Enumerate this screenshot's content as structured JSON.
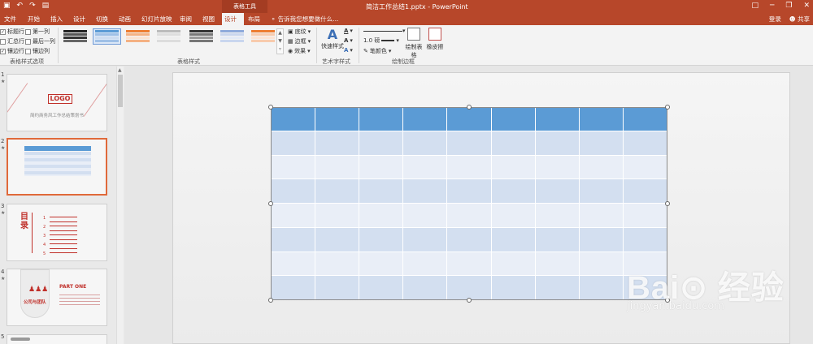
{
  "titlebar": {
    "quick_access": [
      "▣",
      "↶",
      "↷",
      "▤"
    ],
    "context_tab": "表格工具",
    "doc_title": "简洁工作总结1.pptx - PowerPoint",
    "win_buttons": [
      "□",
      "─",
      "❐",
      "✕"
    ]
  },
  "tabs": [
    {
      "label": "文件"
    },
    {
      "label": "开始"
    },
    {
      "label": "插入"
    },
    {
      "label": "设计"
    },
    {
      "label": "切换"
    },
    {
      "label": "动画"
    },
    {
      "label": "幻灯片放映"
    },
    {
      "label": "审阅"
    },
    {
      "label": "视图"
    },
    {
      "label": "设计"
    },
    {
      "label": "布局"
    }
  ],
  "tell_me": "告诉我您想要做什么...",
  "login": "登录",
  "share": "共享",
  "ribbon": {
    "style_options": {
      "label": "表格样式选项",
      "items": [
        "标题行",
        "第一列",
        "汇总行",
        "最后一列",
        "镶边行",
        "镶边列"
      ]
    },
    "table_styles": {
      "label": "表格样式",
      "shading": "底纹",
      "borders": "边框",
      "effects": "效果"
    },
    "wordart": {
      "label": "艺术字样式",
      "quick_styles": "快速样式"
    },
    "draw_borders": {
      "label": "绘制边框",
      "pen_weight": "1.0 磅",
      "pen_color": "笔颜色",
      "draw_table": "绘制表格",
      "eraser": "橡皮擦"
    }
  },
  "slides": [
    {
      "num": "1",
      "logo": "LOGO",
      "title": "简约商务风工作总结策划书"
    },
    {
      "num": "2"
    },
    {
      "num": "3",
      "heading": "目录",
      "items": [
        "1",
        "2",
        "3",
        "4",
        "5"
      ]
    },
    {
      "num": "4",
      "part": "PART ONE",
      "team": "公司与团队"
    },
    {
      "num": "5"
    }
  ],
  "colors": {
    "accent": "#b7472a",
    "table_header": "#5b9bd5",
    "table_band_even": "#d3dff0",
    "table_band_odd": "#e9eef7"
  },
  "watermark": {
    "text": "Bai⊙ 经验",
    "url": "jingyan.baidu.com"
  }
}
